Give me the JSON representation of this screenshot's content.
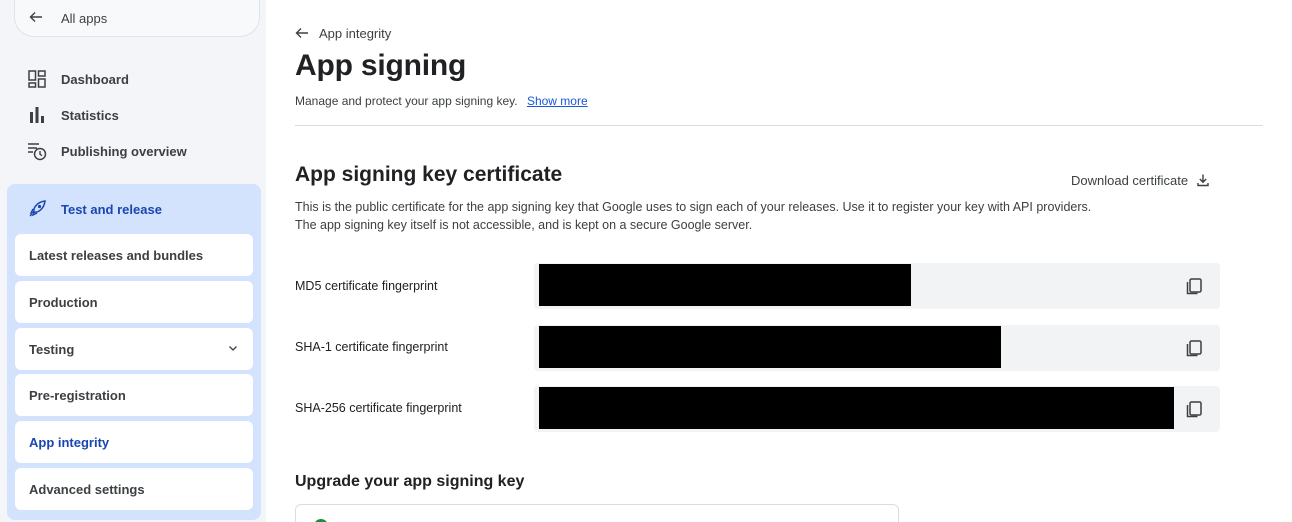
{
  "sidebar": {
    "all_apps": "All apps",
    "items": [
      {
        "label": "Dashboard",
        "icon": "dashboard-icon"
      },
      {
        "label": "Statistics",
        "icon": "bar-chart-icon"
      },
      {
        "label": "Publishing overview",
        "icon": "publishing-clock-icon"
      }
    ],
    "release": {
      "label": "Test and release",
      "icon": "rocket-icon",
      "sub_items": [
        {
          "label": "Latest releases and bundles"
        },
        {
          "label": "Production"
        },
        {
          "label": "Testing"
        },
        {
          "label": "Pre-registration"
        },
        {
          "label": "App integrity"
        },
        {
          "label": "Advanced settings"
        }
      ]
    }
  },
  "main": {
    "breadcrumb": "App integrity",
    "title": "App signing",
    "subtitle": "Manage and protect your app signing key.",
    "show_more": "Show more",
    "section": {
      "title": "App signing key certificate",
      "download_label": "Download certificate",
      "description": "This is the public certificate for the app signing key that Google uses to sign each of your releases. Use it to register your key with API providers. The app signing key itself is not accessible, and is kept on a secure Google server.",
      "fingerprints": [
        {
          "label": "MD5 certificate fingerprint"
        },
        {
          "label": "SHA-1 certificate fingerprint"
        },
        {
          "label": "SHA-256 certificate fingerprint"
        }
      ]
    },
    "upgrade_title": "Upgrade your app signing key"
  },
  "colors": {
    "accent": "#1a46b0",
    "link": "#1a56db",
    "nav_highlight": "#d3e3fd"
  }
}
